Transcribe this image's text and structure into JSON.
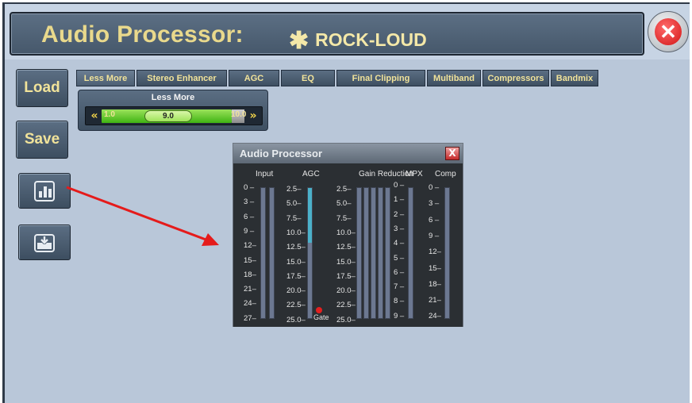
{
  "window": {
    "title": "Audio Processor:",
    "preset_star": "✱",
    "preset_name": "ROCK-LOUD"
  },
  "sidebar": {
    "load_label": "Load",
    "save_label": "Save"
  },
  "tabs": [
    {
      "label": "Less More",
      "active": true
    },
    {
      "label": "Stereo Enhancer"
    },
    {
      "label": "AGC"
    },
    {
      "label": "EQ"
    },
    {
      "label": "Final Clipping"
    },
    {
      "label": "Multiband"
    },
    {
      "label": "Compressors"
    },
    {
      "label": "Bandmix"
    }
  ],
  "slider": {
    "label": "Less More",
    "min": "1.0",
    "value": "9.0",
    "max": "10.0",
    "fill_fraction": 0.89
  },
  "popup": {
    "title": "Audio Processor",
    "close": "X",
    "columns": {
      "input": "Input",
      "agc": "AGC",
      "gain_reduction": "Gain Reduction",
      "mpx": "MPX",
      "comp": "Comp"
    },
    "input_scale": [
      "0 –",
      "3 –",
      "6 –",
      "9 –",
      "12–",
      "15–",
      "18–",
      "21–",
      "24–",
      "27–"
    ],
    "agc_scale": [
      "2.5–",
      "5.0–",
      "7.5–",
      "10.0–",
      "12.5–",
      "15.0–",
      "17.5–",
      "20.0–",
      "22.5–",
      "25.0–"
    ],
    "gr_scale": [
      "2.5–",
      "5.0–",
      "7.5–",
      "10.0–",
      "12.5–",
      "15.0–",
      "17.5–",
      "20.0–",
      "22.5–",
      "25.0–"
    ],
    "mpx_scale": [
      "0 –",
      "1 –",
      "2 –",
      "3 –",
      "4 –",
      "5 –",
      "6 –",
      "7 –",
      "8 –",
      "9 –"
    ],
    "comp_scale": [
      "0 –",
      "3 –",
      "6 –",
      "9 –",
      "12–",
      "15–",
      "18–",
      "21–",
      "24–"
    ],
    "gate_label": "Gate",
    "agc_level_fraction": 0.42
  },
  "colors": {
    "title_text": "#e9d98c",
    "accent_green": "#3fb313",
    "close_red": "#d21616",
    "meter_fill": "#4bb1c9",
    "annotation_arrow": "#e51b1b"
  }
}
